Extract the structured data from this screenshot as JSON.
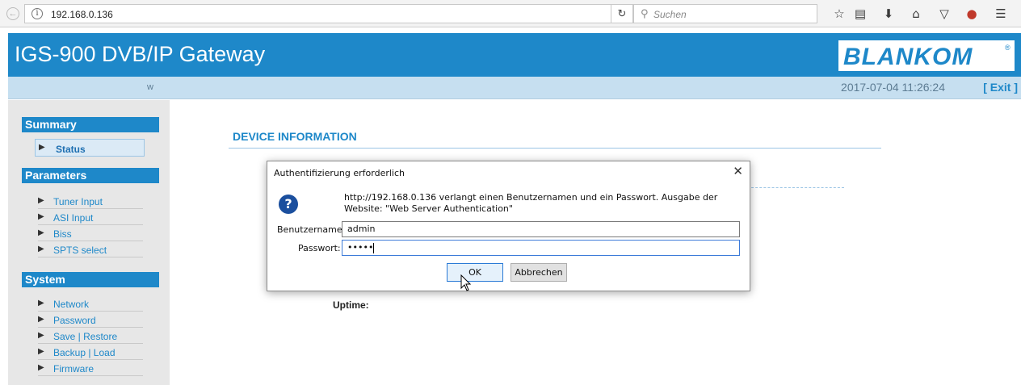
{
  "browser": {
    "url": "192.168.0.136",
    "search_placeholder": "Suchen",
    "reload_icon": "reload-icon",
    "toolbar_icons": [
      "bookmark-star-icon",
      "reading-list-icon",
      "download-icon",
      "home-icon",
      "pocket-icon",
      "ublock-icon",
      "menu-icon"
    ]
  },
  "header": {
    "title": "IGS-900 DVB/IP Gateway",
    "logo_text": "BLANKOM",
    "logo_mark": "®",
    "user": "w",
    "datetime": "2017-07-04 11:26:24",
    "exit_label": "[ Exit ]",
    "brand_color": "#1e88c9"
  },
  "sidebar": {
    "summary": {
      "heading": "Summary",
      "items": [
        {
          "label": "Status"
        }
      ]
    },
    "parameters": {
      "heading": "Parameters",
      "items": [
        {
          "label": "Tuner Input"
        },
        {
          "label": "ASI Input"
        },
        {
          "label": "Biss"
        },
        {
          "label": "SPTS select"
        }
      ]
    },
    "system": {
      "heading": "System",
      "items": [
        {
          "label": "Network"
        },
        {
          "label": "Password"
        },
        {
          "label": "Save | Restore"
        },
        {
          "label": "Backup | Load"
        },
        {
          "label": "Firmware"
        }
      ]
    }
  },
  "main": {
    "title": "DEVICE INFORMATION",
    "uptime_label": "Uptime:"
  },
  "dialog": {
    "title": "Authentifizierung erforderlich",
    "message": "http://192.168.0.136 verlangt einen Benutzernamen und ein Passwort. Ausgabe der Website: \"Web Server Authentication\"",
    "username_label": "Benutzername:",
    "username_value": "admin",
    "password_label": "Passwort:",
    "password_value": "•••••",
    "ok_label": "OK",
    "cancel_label": "Abbrechen"
  }
}
